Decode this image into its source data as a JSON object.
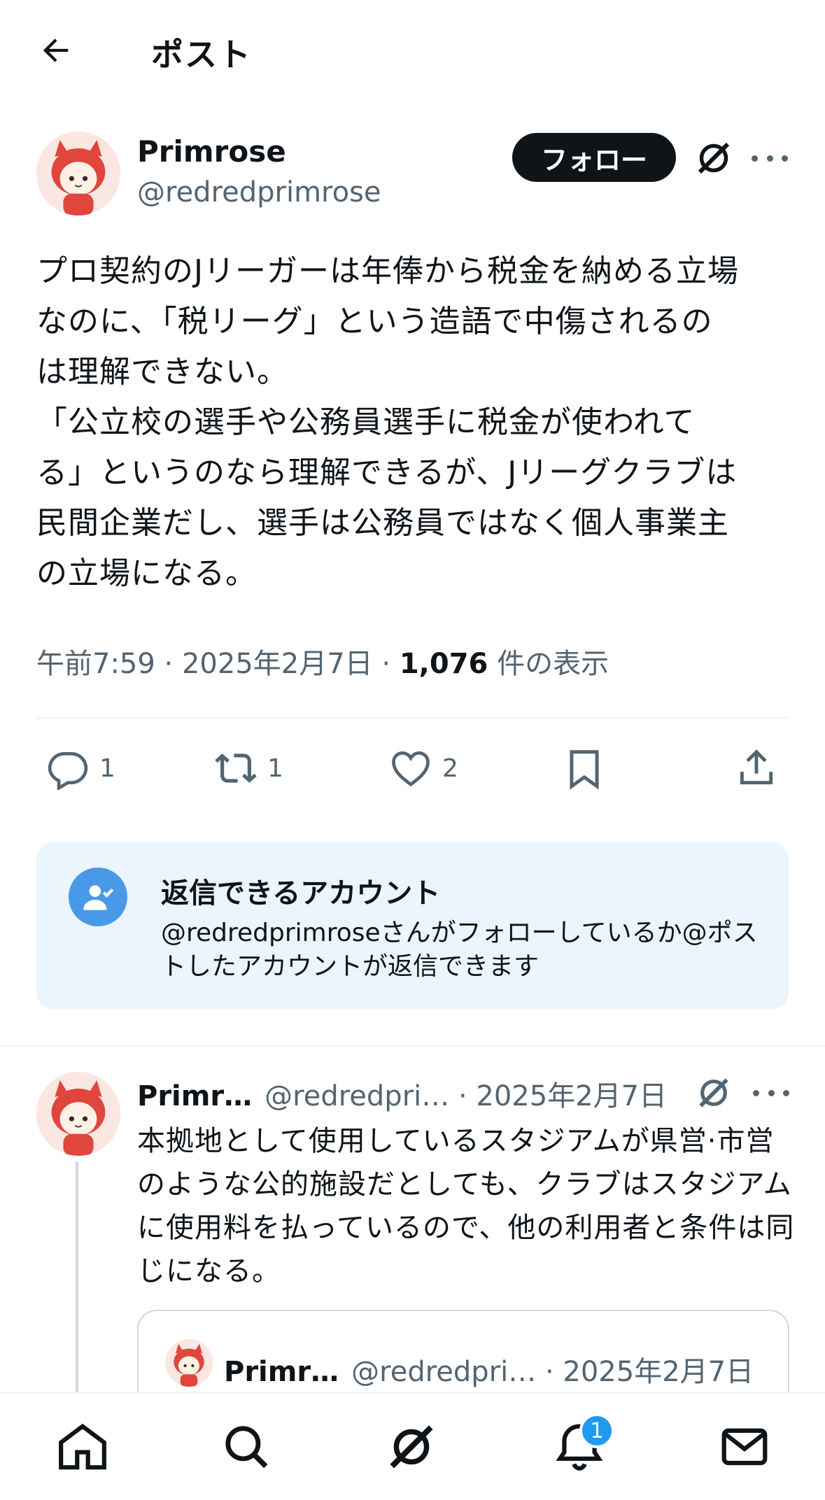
{
  "header": {
    "title": "ポスト",
    "back_icon": "arrow-left-icon"
  },
  "post": {
    "author_name": "Primrose",
    "author_handle": "@redredprimrose",
    "follow_label": "フォロー",
    "text": "プロ契約のJリーガーは年俸から税金を納める立場\nなのに、「税リーグ」という造語で中傷されるの\nは理解できない。\n「公立校の選手や公務員選手に税金が使われて\nる」というのなら理解できるが、Jリーグクラブは\n民間企業だし、選手は公務員ではなく個人事業主\nの立場になる。",
    "time": "午前7:59",
    "date": "2025年2月7日",
    "views_count": "1,076",
    "views_label": "件の表示",
    "sep": " · "
  },
  "actions": {
    "reply_count": "1",
    "repost_count": "1",
    "like_count": "2"
  },
  "reply_restriction": {
    "title": "返信できるアカウント",
    "description": "@redredprimroseさんがフォローしているか@ポストしたアカウントが返信できます"
  },
  "reply": {
    "author_name": "Primr…",
    "author_handle": "@redredpri…",
    "date": " · 2025年2月7日",
    "text": "本拠地として使用しているスタジアムが県営·市営のような公的施設だとしても、クラブはスタジアムに使用料を払っているので、他の利用者と条件は同じになる。"
  },
  "quote": {
    "author_name": "Primr…",
    "author_handle": "@redredpri…",
    "date": " · 2025年2月7日"
  },
  "nav": {
    "notification_badge": "1"
  },
  "colors": {
    "accent": "#1d9bf0",
    "text_primary": "#0f1419",
    "text_secondary": "#536471",
    "reply_box_bg": "#eaf5fd"
  }
}
